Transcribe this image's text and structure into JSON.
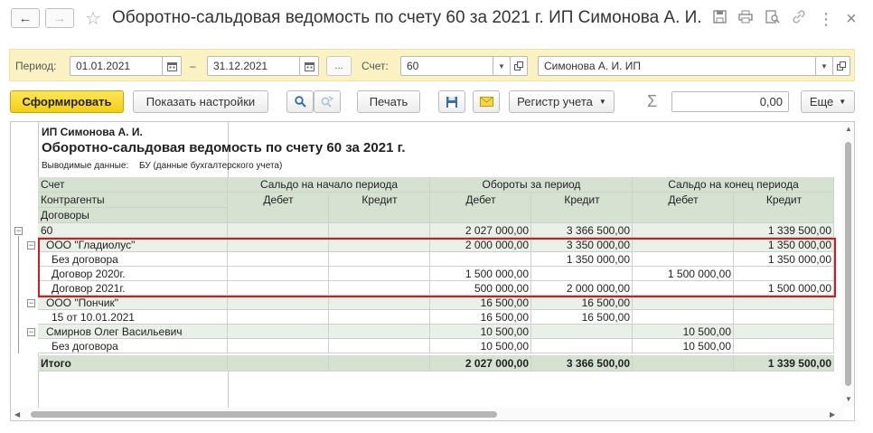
{
  "titlebar": {
    "back_icon": "arrow-left-icon",
    "forward_icon": "arrow-right-icon",
    "title": "Оборотно-сальдовая ведомость по счету 60 за 2021 г. ИП Симонова А. И.",
    "star_glyph": "☆",
    "close_glyph": "×",
    "more_glyph": "⋮"
  },
  "filters": {
    "period_label": "Период:",
    "date_from": "01.01.2021",
    "dash": "–",
    "date_to": "31.12.2021",
    "dots": "...",
    "account_label": "Счет:",
    "account_value": "60",
    "org_value": "Симонова А. И. ИП"
  },
  "toolbar": {
    "generate": "Сформировать",
    "show_settings": "Показать настройки",
    "print": "Печать",
    "register": "Регистр учета",
    "sigma": "Σ",
    "sum_value": "0,00",
    "more": "Еще"
  },
  "report": {
    "org": "ИП Симонова А. И.",
    "heading": "Оборотно-сальдовая ведомость по счету 60 за 2021 г.",
    "output_label": "Выводимые данные:",
    "output_value": "БУ (данные бухгалтерского учета)",
    "columns": {
      "account": "Счет",
      "contractors": "Контрагенты",
      "contracts": "Договоры",
      "opening": "Сальдо на начало периода",
      "turnover": "Обороты за период",
      "closing": "Сальдо на конец периода",
      "debit": "Дебет",
      "credit": "Кредит"
    },
    "rows": [
      {
        "label": "60",
        "indent": 0,
        "values": [
          "",
          "",
          "2 027 000,00",
          "3 366 500,00",
          "",
          "1 339 500,00"
        ]
      },
      {
        "label": "ООО \"Гладиолус\"",
        "indent": 1,
        "values": [
          "",
          "",
          "2 000 000,00",
          "3 350 000,00",
          "",
          "1 350 000,00"
        ]
      },
      {
        "label": "Без договора",
        "indent": 2,
        "values": [
          "",
          "",
          "",
          "1 350 000,00",
          "",
          "1 350 000,00"
        ]
      },
      {
        "label": "Договор 2020г.",
        "indent": 2,
        "values": [
          "",
          "",
          "1 500 000,00",
          "",
          "1 500 000,00",
          ""
        ]
      },
      {
        "label": "Договор 2021г.",
        "indent": 2,
        "values": [
          "",
          "",
          "500 000,00",
          "2 000 000,00",
          "",
          "1 500 000,00"
        ]
      },
      {
        "label": "ООО \"Пончик\"",
        "indent": 1,
        "values": [
          "",
          "",
          "16 500,00",
          "16 500,00",
          "",
          ""
        ]
      },
      {
        "label": "15 от 10.01.2021",
        "indent": 2,
        "values": [
          "",
          "",
          "16 500,00",
          "16 500,00",
          "",
          ""
        ]
      },
      {
        "label": "Смирнов Олег Васильевич",
        "indent": 1,
        "values": [
          "",
          "",
          "10 500,00",
          "",
          "10 500,00",
          ""
        ]
      },
      {
        "label": "Без договора",
        "indent": 2,
        "values": [
          "",
          "",
          "10 500,00",
          "",
          "10 500,00",
          ""
        ]
      }
    ],
    "total": {
      "label": "Итого",
      "values": [
        "",
        "",
        "2 027 000,00",
        "3 366 500,00",
        "",
        "1 339 500,00"
      ]
    }
  },
  "colors": {
    "accent_yellow": "#f3cf10",
    "filter_bg": "#fbf2c3",
    "header_green": "#d5e2d2",
    "highlight_red": "#d9171c"
  }
}
